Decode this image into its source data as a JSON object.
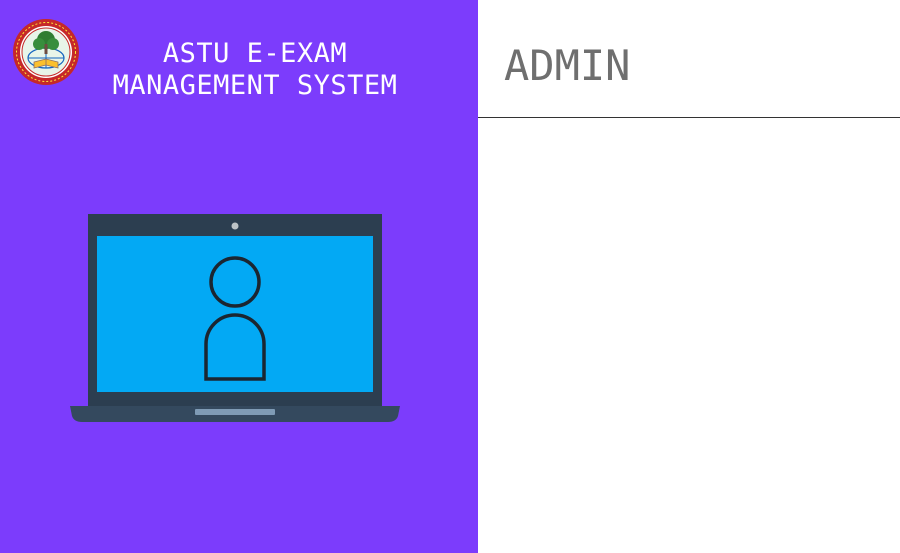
{
  "app": {
    "title_line1": "ASTU E-EXAM",
    "title_line2": "MANAGEMENT SYSTEM"
  },
  "logo": {
    "icon": "university-seal-icon"
  },
  "illustration": {
    "icon": "laptop-user-icon"
  },
  "main": {
    "heading": "ADMIN"
  },
  "colors": {
    "sidebar_bg": "#7c3cfc",
    "screen_bg": "#03a9f4",
    "laptop_body": "#2c3e50",
    "heading_text": "#6f6f6f"
  }
}
